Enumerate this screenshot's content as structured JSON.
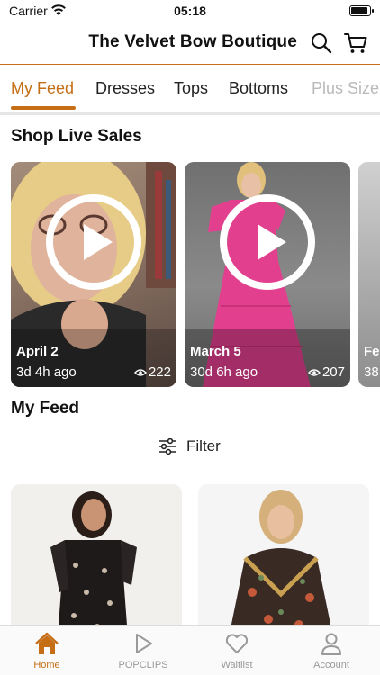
{
  "status_bar": {
    "carrier": "Carrier",
    "time": "05:18"
  },
  "header": {
    "title": "The Velvet Bow Boutique"
  },
  "tabs": [
    {
      "label": "My Feed",
      "active": true
    },
    {
      "label": "Dresses"
    },
    {
      "label": "Tops"
    },
    {
      "label": "Bottoms"
    },
    {
      "label": "Plus Size"
    }
  ],
  "live_sales": {
    "title": "Shop Live Sales",
    "cards": [
      {
        "date": "April 2",
        "ago": "3d 4h ago",
        "views": "222"
      },
      {
        "date": "March 5",
        "ago": "30d 6h ago",
        "views": "207"
      },
      {
        "date": "Fe",
        "ago": "38"
      }
    ]
  },
  "feed": {
    "title": "My Feed",
    "filter_label": "Filter"
  },
  "bottom_nav": [
    {
      "label": "Home",
      "active": true
    },
    {
      "label": "POPCLIPS"
    },
    {
      "label": "Waitlist"
    },
    {
      "label": "Account"
    }
  ],
  "colors": {
    "accent": "#c56e16",
    "pink_dress": "#e2408f"
  }
}
